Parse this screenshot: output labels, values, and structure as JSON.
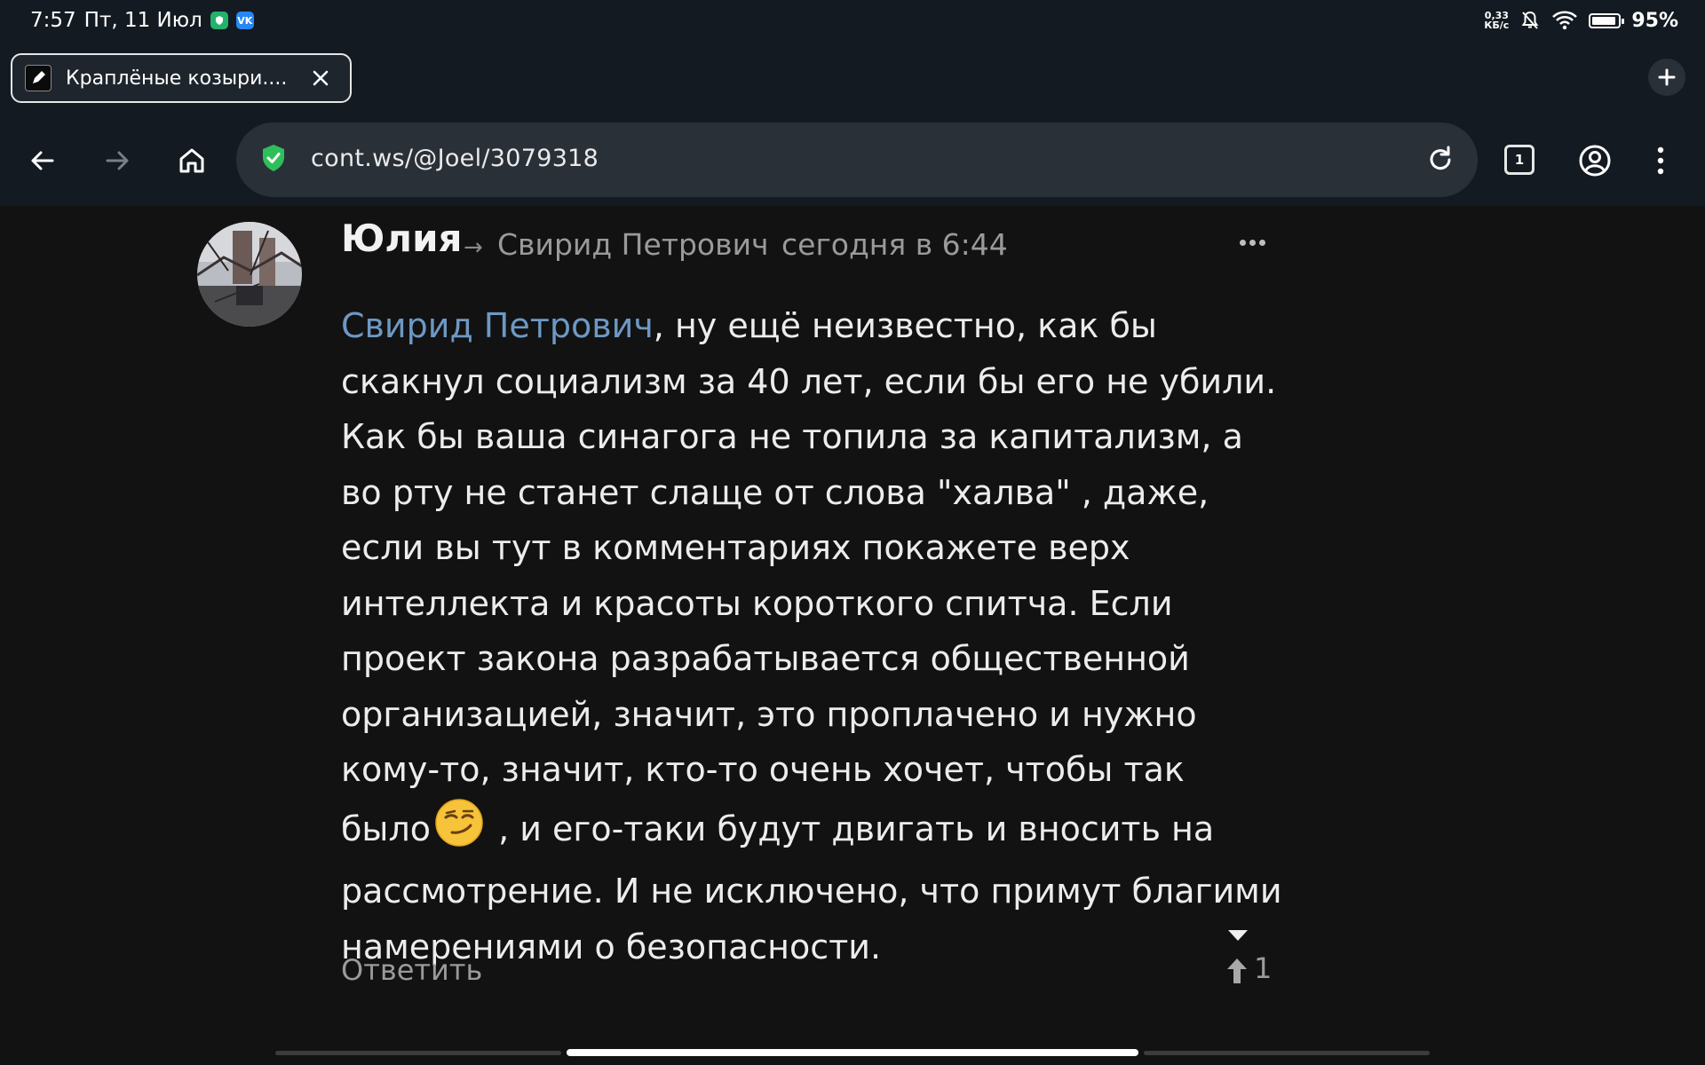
{
  "status_bar": {
    "time": "7:57",
    "date": "Пт, 11 Июл",
    "net_speed_value": "0,33",
    "net_speed_unit": "КБ/с",
    "battery": "95%"
  },
  "tab": {
    "title": "Краплёные козыри...."
  },
  "toolbar": {
    "url": "cont.ws/@Joel/3079318",
    "tab_count": "1"
  },
  "comment": {
    "author": "Юлия",
    "arrow": "→",
    "recipient": "Свирид Петрович",
    "timestamp": "сегодня в 6:44",
    "mention": "Свирид Петрович",
    "text_part1": ", ну ещё неизвестно, как бы скакнул социализм за 40 лет, если бы его не убили. Как бы ваша синагога не топила за капитализм, а во рту не станет слаще от слова \"халва\" , даже, если вы тут в комментариях покажете верх интеллекта и красоты короткого спитча. Если проект закона разрабатывается общественной организацией, значит, это проплачено и нужно кому-то, значит, кто-то очень хочет, чтобы так было",
    "text_part2": " , и его-таки будут двигать и вносить на рассмотрение. И не исключено, что примут благими намерениями о безопасности.",
    "reply_label": "Ответить",
    "vote_count": "1"
  },
  "colors": {
    "background": "#121212",
    "chrome": "#141a21",
    "mention": "#6e98c4",
    "secure_shield": "#2fbf5a"
  }
}
